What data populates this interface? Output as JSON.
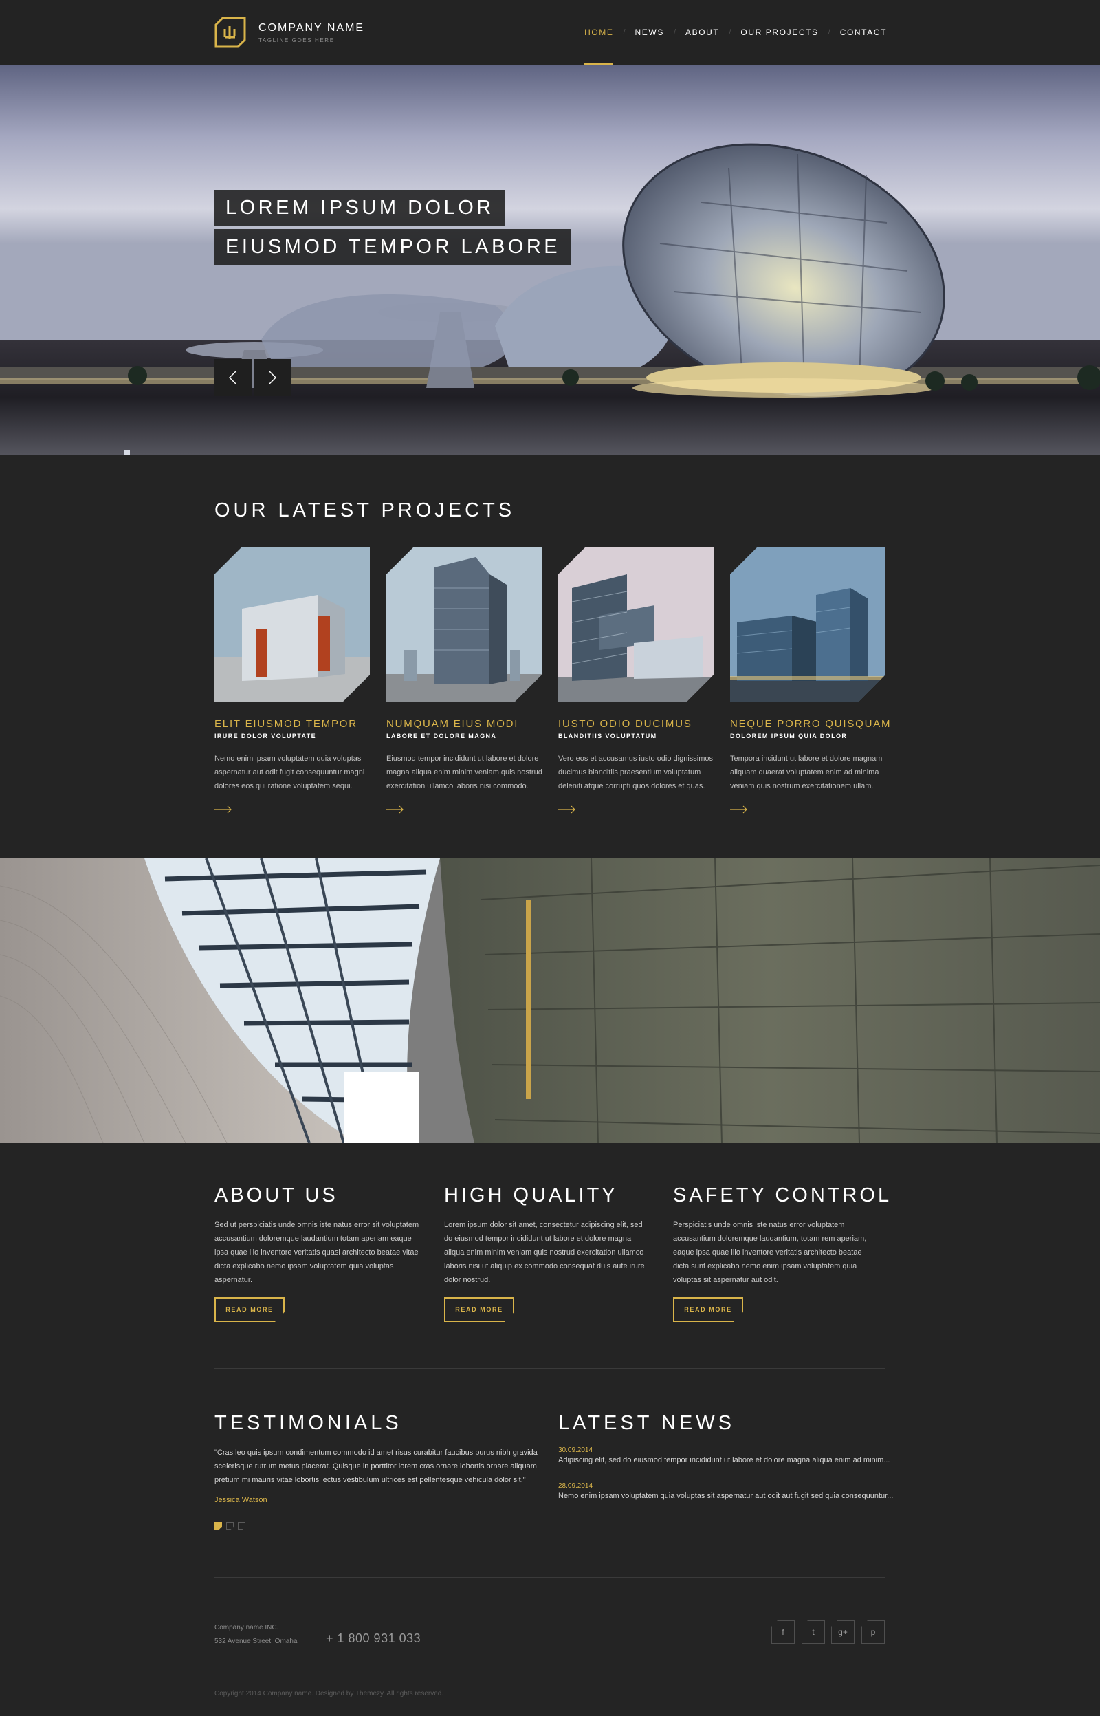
{
  "header": {
    "company_name": "COMPANY NAME",
    "tagline": "TAGLINE GOES HERE",
    "nav": [
      "HOME",
      "NEWS",
      "ABOUT",
      "OUR PROJECTS",
      "CONTACT"
    ],
    "active_nav": "HOME"
  },
  "hero": {
    "line1": "LOREM IPSUM DOLOR",
    "line2": "EIUSMOD TEMPOR LABORE",
    "prev_icon": "chevron-left-icon",
    "next_icon": "chevron-right-icon"
  },
  "projects": {
    "title": "OUR LATEST PROJECTS",
    "items": [
      {
        "title": "ELIT EIUSMOD TEMPOR",
        "subtitle": "IRURE DOLOR VOLUPTATE",
        "text": "Nemo enim ipsam voluptatem quia voluptas aspernatur aut odit fugit consequuntur magni dolores eos qui ratione voluptatem sequi."
      },
      {
        "title": "NUMQUAM EIUS MODI",
        "subtitle": "LABORE ET DOLORE MAGNA",
        "text": "Eiusmod tempor incididunt ut labore et dolore magna aliqua enim minim veniam quis nostrud exercitation ullamco laboris nisi commodo."
      },
      {
        "title": "IUSTO ODIO DUCIMUS",
        "subtitle": "BLANDITIIS VOLUPTATUM",
        "text": "Vero eos et accusamus iusto odio dignissimos ducimus blanditiis praesentium voluptatum deleniti atque corrupti quos dolores et quas."
      },
      {
        "title": "NEQUE PORRO QUISQUAM",
        "subtitle": "DOLOREM IPSUM QUIA DOLOR",
        "text": "Tempora incidunt ut labore et dolore magnam aliquam quaerat voluptatem enim ad minima veniam quis nostrum exercitationem ullam."
      }
    ]
  },
  "features": [
    {
      "title": "ABOUT US",
      "text": "Sed ut perspiciatis unde omnis iste natus error sit voluptatem accusantium doloremque laudantium totam aperiam eaque ipsa quae illo inventore veritatis quasi architecto beatae vitae dicta explicabo nemo ipsam voluptatem quia voluptas aspernatur.",
      "button": "READ MORE"
    },
    {
      "title": "HIGH QUALITY",
      "text": "Lorem ipsum dolor sit amet, consectetur adipiscing elit, sed do eiusmod tempor incididunt ut labore et dolore magna aliqua enim minim veniam quis nostrud exercitation ullamco laboris nisi ut aliquip ex commodo consequat duis aute irure dolor nostrud.",
      "button": "READ MORE"
    },
    {
      "title": "SAFETY CONTROL",
      "text": "Perspiciatis unde omnis iste natus error voluptatem accusantium doloremque laudantium, totam rem aperiam, eaque ipsa quae illo inventore veritatis architecto beatae dicta sunt explicabo nemo enim ipsam voluptatem quia voluptas sit aspernatur aut odit.",
      "button": "READ MORE"
    }
  ],
  "testimonials": {
    "title": "TESTIMONIALS",
    "quote": "\"Cras leo quis ipsum condimentum commodo id amet risus curabitur faucibus purus nibh gravida scelerisque rutrum metus placerat. Quisque in porttitor lorem cras ornare lobortis ornare aliquam pretium mi mauris vitae lobortis lectus vestibulum ultrices est pellentesque vehicula dolor sit.\"",
    "author": "Jessica Watson"
  },
  "news": {
    "title": "LATEST NEWS",
    "items": [
      {
        "date": "30.09.2014",
        "text": "Adipiscing elit, sed do eiusmod tempor incididunt ut labore et dolore magna aliqua enim ad minim..."
      },
      {
        "date": "28.09.2014",
        "text": "Nemo enim ipsam voluptatem quia voluptas sit aspernatur aut odit aut fugit sed quia consequuntur..."
      }
    ]
  },
  "footer": {
    "company_line1": "Company name INC.",
    "company_line2": "532 Avenue Street, Omaha",
    "phone": "+ 1 800 931 033",
    "social": [
      "f",
      "t",
      "g+",
      "p"
    ],
    "social_icons": [
      "facebook-icon",
      "twitter-icon",
      "google-plus-icon",
      "pinterest-icon"
    ],
    "copyright": "Copyright 2014 Company name. Designed by Themezy. All rights reserved."
  },
  "colors": {
    "accent": "#d9b44a",
    "background": "#242424",
    "header": "#232323"
  }
}
